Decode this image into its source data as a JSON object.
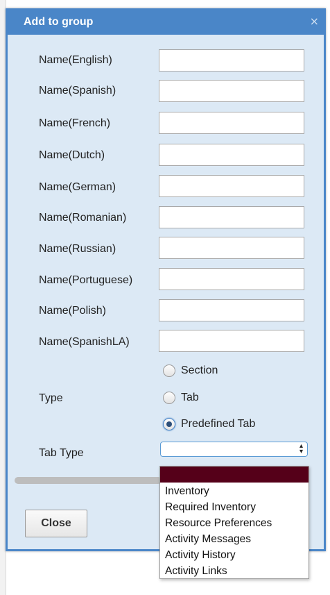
{
  "dialog": {
    "title": "Add to group",
    "close_glyph": "×"
  },
  "fields": [
    {
      "label": "Name(English)",
      "value": ""
    },
    {
      "label": "Name(Spanish)",
      "value": ""
    },
    {
      "label": "Name(French)",
      "value": ""
    },
    {
      "label": "Name(Dutch)",
      "value": ""
    },
    {
      "label": "Name(German)",
      "value": ""
    },
    {
      "label": "Name(Romanian)",
      "value": ""
    },
    {
      "label": "Name(Russian)",
      "value": ""
    },
    {
      "label": "Name(Portuguese)",
      "value": ""
    },
    {
      "label": "Name(Polish)",
      "value": ""
    },
    {
      "label": "Name(SpanishLA)",
      "value": ""
    }
  ],
  "type": {
    "label": "Type",
    "options": [
      "Section",
      "Tab",
      "Predefined Tab"
    ],
    "selected": "Predefined Tab"
  },
  "tab_type": {
    "label": "Tab Type",
    "value": "",
    "options": [
      "",
      "Inventory",
      "Required Inventory",
      "Resource Preferences",
      "Activity Messages",
      "Activity History",
      "Activity Links"
    ],
    "highlighted_color": "#550019"
  },
  "footer": {
    "close_label": "Close"
  },
  "colors": {
    "titlebar": "#4a86c8",
    "dialog_bg": "#dce9f5"
  }
}
